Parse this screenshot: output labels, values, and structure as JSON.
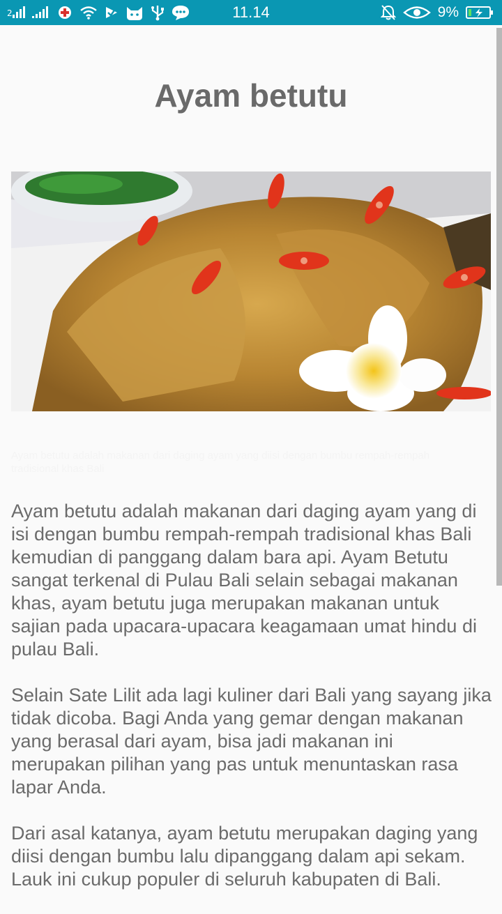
{
  "status_bar": {
    "time": "11.14",
    "battery_percent": "9%",
    "icons_left": [
      "sim-signal-icon",
      "signal-icon",
      "debug-icon",
      "wifi-icon",
      "check-icon",
      "cat-icon",
      "usb-icon",
      "chat-icon"
    ],
    "icons_right": [
      "bell-off-icon",
      "eye-icon",
      "battery-charging-icon"
    ]
  },
  "article": {
    "title": "Ayam betutu",
    "image_caption": "Ayam betutu adalah makanan dari daging ayam yang diisi dengan bumbu rempah-rempah tradisional khas Bali",
    "paragraphs": [
      "Ayam betutu adalah makanan dari daging ayam yang di isi dengan bumbu rempah-rempah tradisional khas Bali kemudian di panggang dalam bara api. Ayam Betutu sangat terkenal di Pulau Bali selain sebagai makanan khas, ayam betutu juga merupakan makanan untuk sajian pada upacara-upacara keagamaan umat hindu di pulau Bali.",
      "Selain Sate Lilit ada lagi kuliner dari Bali yang sayang jika tidak dicoba. Bagi Anda yang gemar dengan makanan yang berasal dari ayam, bisa jadi makanan ini merupakan pilihan yang pas untuk menuntaskan rasa lapar Anda.",
      "Dari asal katanya, ayam betutu merupakan daging yang diisi dengan bumbu lalu dipanggang dalam api sekam. Lauk ini cukup populer di seluruh kabupaten di Bali."
    ]
  },
  "colors": {
    "status_bar": "#0a97b3",
    "background": "#fafafa",
    "title": "#6a6a6a",
    "body_text": "#6b6b6b"
  }
}
